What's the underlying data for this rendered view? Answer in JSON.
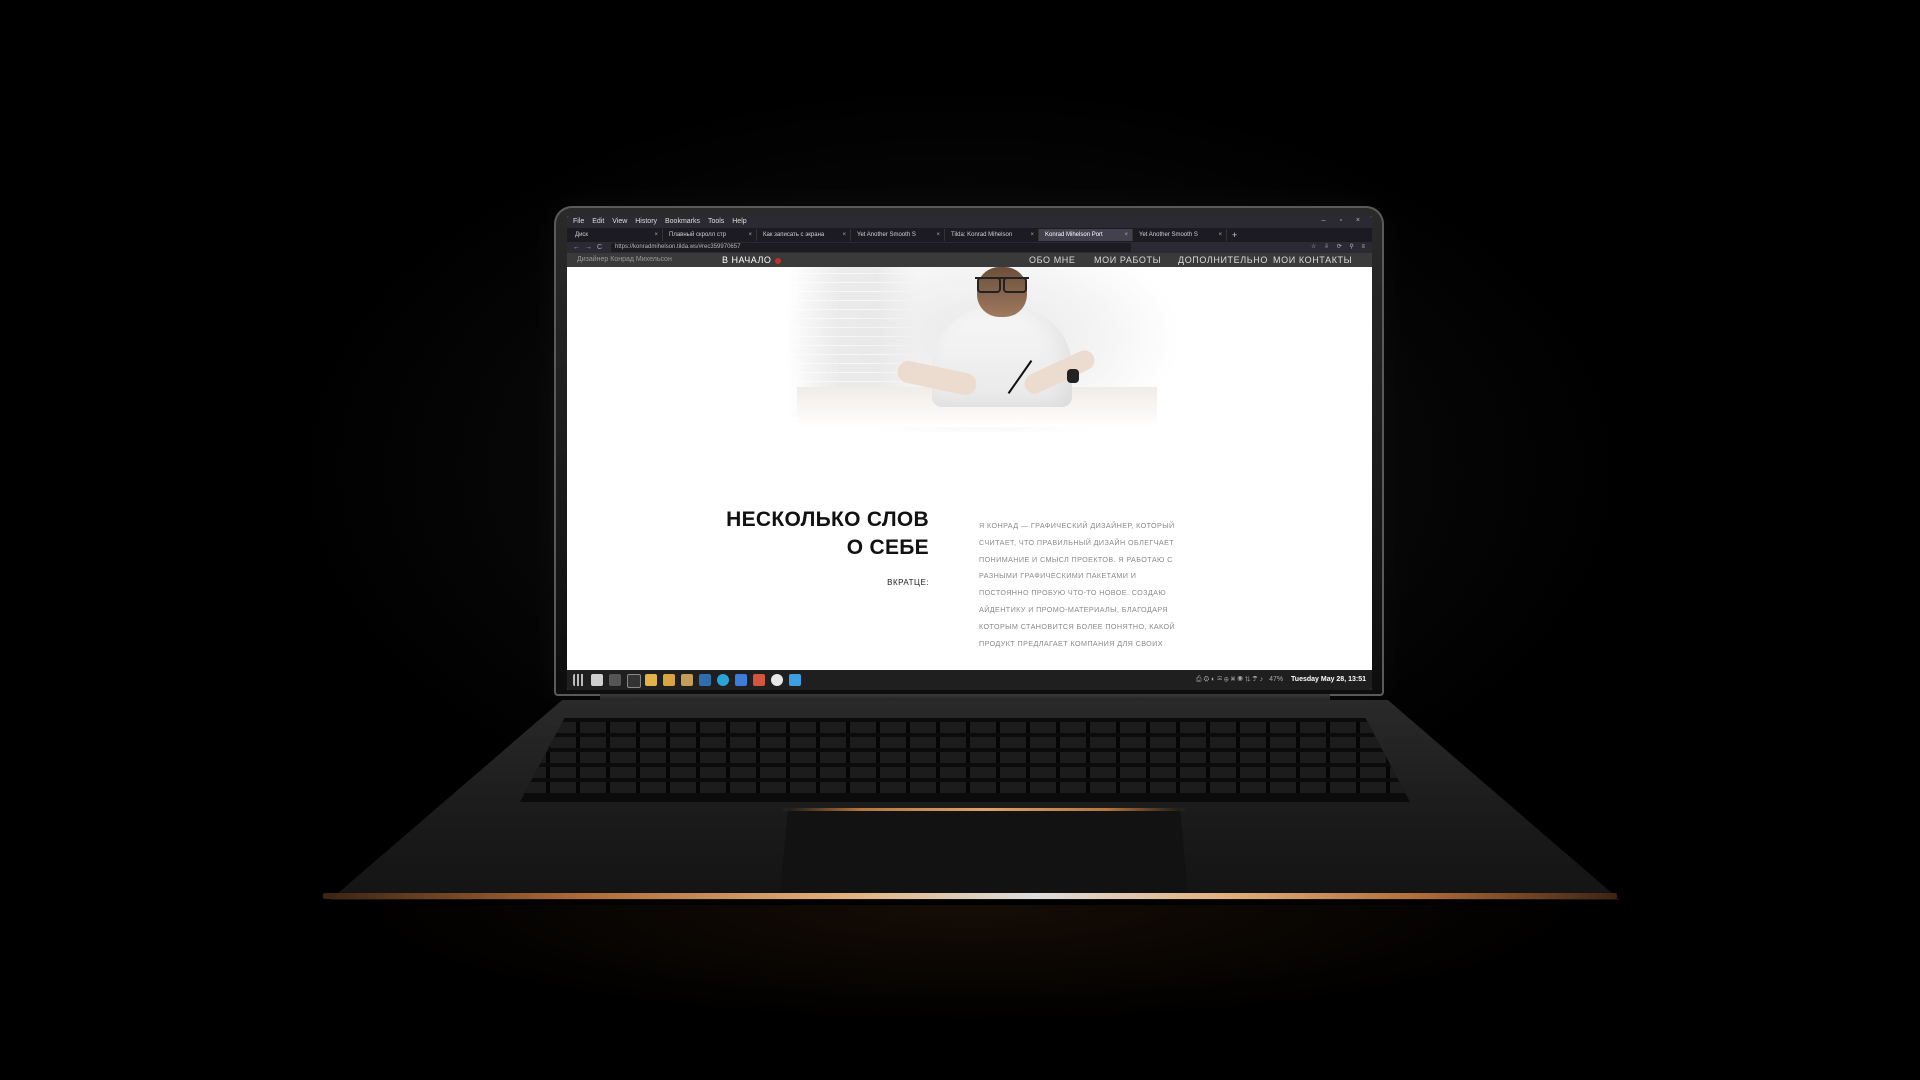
{
  "browser": {
    "menu": [
      "File",
      "Edit",
      "View",
      "History",
      "Bookmarks",
      "Tools",
      "Help"
    ],
    "window_controls": "– ▫ ×",
    "tabs": [
      {
        "label": "Диск"
      },
      {
        "label": "Плавный скролл стр"
      },
      {
        "label": "Как записать с экрана"
      },
      {
        "label": "Yet Another Smooth S"
      },
      {
        "label": "Tilda: Konrad Mihelson"
      },
      {
        "label": "Konrad Mihelson Port"
      },
      {
        "label": "Yet Another Smooth S"
      }
    ],
    "active_tab_index": 5,
    "tab_close": "×",
    "new_tab": "+",
    "url": "https://konradmihelson.tilda.ws/#rec359970657",
    "nav_back": "←",
    "nav_forward": "→",
    "nav_reload": "C",
    "toolbar_icons": "☆ ⇩ ⟳ ⚲ ≡"
  },
  "site": {
    "logo_text": "Дизайнер Конрад Михельсон",
    "home_label": "В НАЧАЛО",
    "nav": [
      "ОБО МНЕ",
      "МОИ РАБОТЫ",
      "ДОПОЛНИТЕЛЬНО",
      "МОИ КОНТАКТЫ"
    ],
    "about": {
      "title_line1": "НЕСКОЛЬКО СЛОВ",
      "title_line2": "О СЕБЕ",
      "subtitle": "ВКРАТЦЕ:",
      "body": "Я Конрад — графический дизайнер, который считает, что правильный дизайн облегчает понимание и смысл проектов. Я работаю с разными графическими пакетами и постоянно пробую что-то новое. Создаю айдентику и промо-материалы, благодаря которым становится более понятно, какой продукт предлагает компания для своих"
    }
  },
  "taskbar": {
    "battery": "47%",
    "datetime": "Tuesday May 28, 13:51",
    "tray_glyphs": "⎙ ⚙ ◐ ✉ ⊕ ⌘ ◉ ⇅ ☂ ♪"
  },
  "colors": {
    "accent_red": "#c0302c",
    "site_header_bg": "#3a3a3a",
    "browser_chrome": "#2b2a33",
    "copper_trim": "#b06a38"
  }
}
